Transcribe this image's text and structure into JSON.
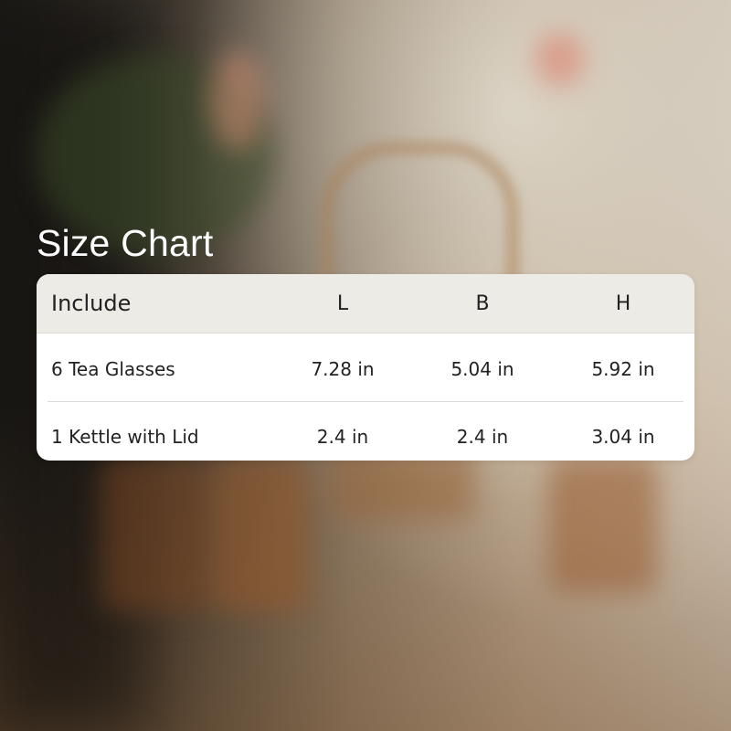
{
  "title": "Size Chart",
  "table": {
    "columns": [
      "Include",
      "L",
      "B",
      "H"
    ],
    "rows": [
      [
        "6 Tea Glasses",
        "7.28 in",
        "5.04 in",
        "5.92 in"
      ],
      [
        "1 Kettle with Lid",
        "2.4 in",
        "2.4 in",
        "3.04 in"
      ]
    ]
  }
}
